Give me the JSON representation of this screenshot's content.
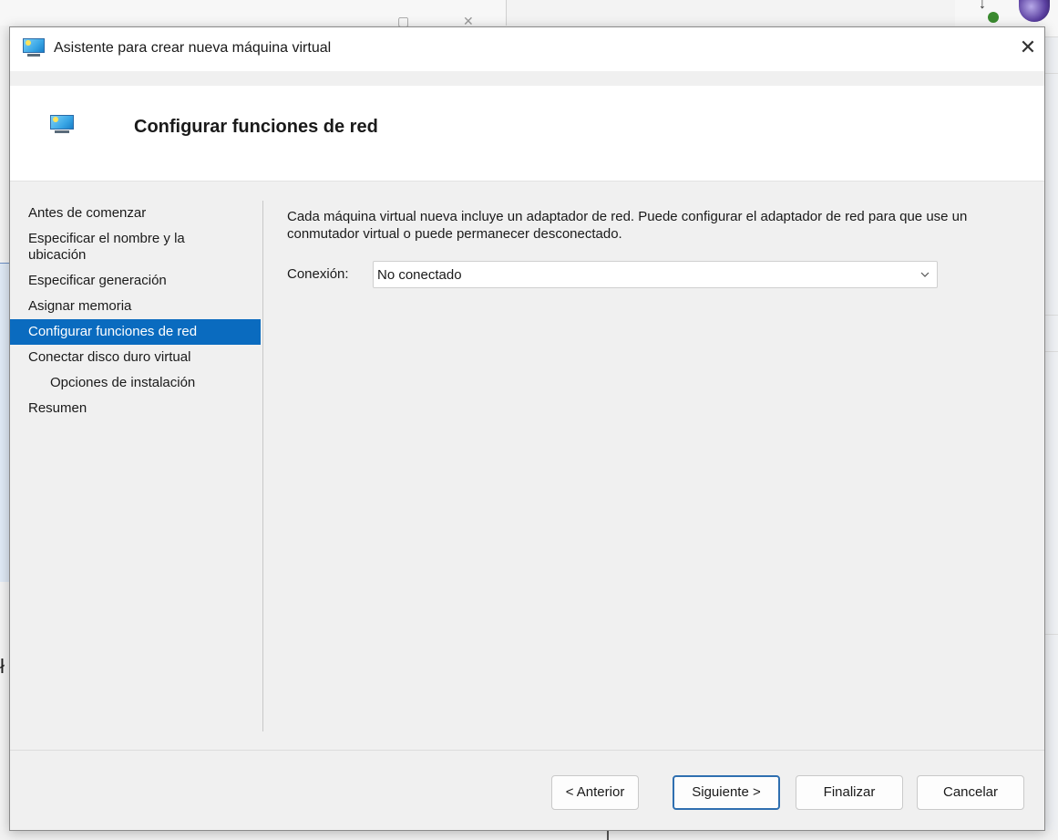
{
  "dialog": {
    "title": "Asistente para crear nueva máquina virtual",
    "header_title": "Configurar funciones de red"
  },
  "nav": {
    "items": [
      {
        "label": "Antes de comenzar",
        "selected": false,
        "indent": false
      },
      {
        "label": "Especificar el nombre y la ubicación",
        "selected": false,
        "indent": false
      },
      {
        "label": "Especificar generación",
        "selected": false,
        "indent": false
      },
      {
        "label": "Asignar memoria",
        "selected": false,
        "indent": false
      },
      {
        "label": "Configurar funciones de red",
        "selected": true,
        "indent": false
      },
      {
        "label": "Conectar disco duro virtual",
        "selected": false,
        "indent": false
      },
      {
        "label": "Opciones de instalación",
        "selected": false,
        "indent": true
      },
      {
        "label": "Resumen",
        "selected": false,
        "indent": false
      }
    ]
  },
  "content": {
    "description": "Cada máquina virtual nueva incluye un adaptador de red. Puede configurar el adaptador de red para que use un conmutador virtual o puede permanecer desconectado.",
    "connection_label": "Conexión:",
    "connection_value": "No conectado"
  },
  "buttons": {
    "previous": "< Anterior",
    "next": "Siguiente >",
    "finish": "Finalizar",
    "cancel": "Cancelar"
  },
  "colors": {
    "selection": "#0a6bbf",
    "primary_border": "#2f6fb0"
  }
}
